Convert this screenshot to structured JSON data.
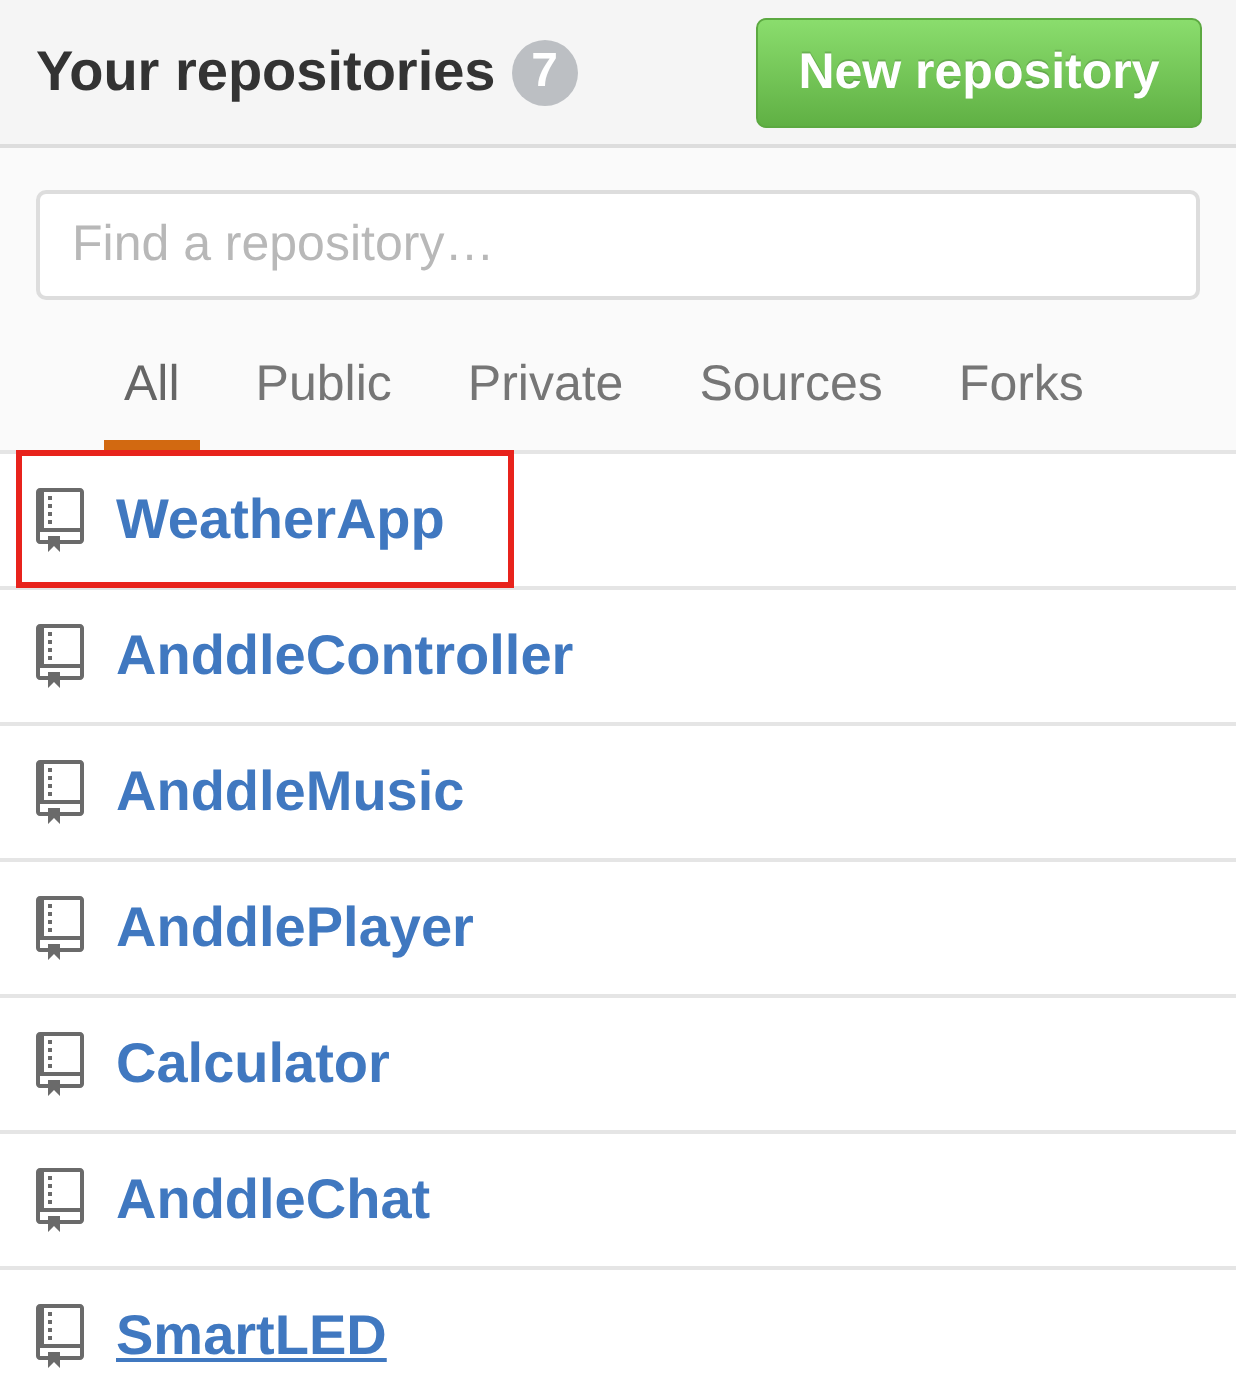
{
  "header": {
    "title": "Your repositories",
    "count": "7",
    "new_button": "New repository"
  },
  "search": {
    "placeholder": "Find a repository…"
  },
  "filters": [
    {
      "label": "All",
      "selected": true
    },
    {
      "label": "Public",
      "selected": false
    },
    {
      "label": "Private",
      "selected": false
    },
    {
      "label": "Sources",
      "selected": false
    },
    {
      "label": "Forks",
      "selected": false
    }
  ],
  "repositories": [
    {
      "name": "WeatherApp",
      "highlighted": true,
      "hovered": false
    },
    {
      "name": "AnddleController",
      "highlighted": false,
      "hovered": false
    },
    {
      "name": "AnddleMusic",
      "highlighted": false,
      "hovered": false
    },
    {
      "name": "AnddlePlayer",
      "highlighted": false,
      "hovered": false
    },
    {
      "name": "Calculator",
      "highlighted": false,
      "hovered": false
    },
    {
      "name": "AnddleChat",
      "highlighted": false,
      "hovered": false
    },
    {
      "name": "SmartLED",
      "highlighted": false,
      "hovered": true
    }
  ]
}
